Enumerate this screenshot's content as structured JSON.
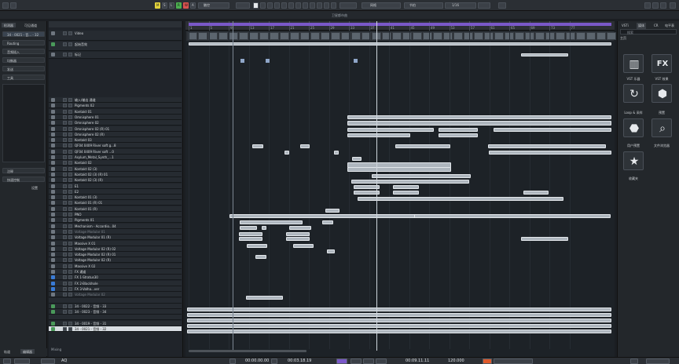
{
  "toolbar": {
    "mode_label": "触控",
    "grid_label": "网格",
    "grid_mode": "节拍",
    "quantize": "1/16",
    "letters": [
      "M",
      "S",
      "L",
      "R",
      "W",
      "A"
    ]
  },
  "window": {
    "project_title": "卫星都市曲"
  },
  "inspector": {
    "tabs": [
      "检测器",
      "可见通道"
    ],
    "track_name": "34 - 0021 - 音... - 32",
    "sections": [
      "Routing",
      "音频插入",
      "均衡器",
      "发送",
      "工具"
    ],
    "lower_sections": [
      "注释",
      "快速控制"
    ],
    "setting_label": "设置",
    "bottom_tabs": [
      "轨道",
      "编辑器"
    ],
    "footer_label": "Mixing"
  },
  "tracks": [
    {
      "name": "Video",
      "type": "video"
    },
    {
      "name": "起始音效",
      "type": "audio"
    },
    {
      "name": "标记",
      "type": "marker"
    },
    {
      "name": "输入/输出 通道",
      "type": "folder"
    },
    {
      "name": "Pigments 02",
      "type": "inst"
    },
    {
      "name": "Kontakt 01",
      "type": "inst"
    },
    {
      "name": "Omnisphere 01",
      "type": "inst"
    },
    {
      "name": "Omnisphere 02",
      "type": "inst"
    },
    {
      "name": "Omnisphere 02 (R) 01",
      "type": "inst"
    },
    {
      "name": "Omnisphere 02 (R)",
      "type": "inst"
    },
    {
      "name": "Kontakt 03",
      "type": "inst"
    },
    {
      "name": "QF04 0409 River soft g...8",
      "type": "inst"
    },
    {
      "name": "QF04 0409 River soft ...0",
      "type": "inst"
    },
    {
      "name": "Asylum_Metal_Synth_...1",
      "type": "inst"
    },
    {
      "name": "Kontakt 02",
      "type": "inst"
    },
    {
      "name": "Kontakt 02 (3)",
      "type": "inst"
    },
    {
      "name": "Kontakt 02 (3) (R) 01",
      "type": "inst"
    },
    {
      "name": "Kontakt 02 (3) (R)",
      "type": "inst"
    },
    {
      "name": "E1",
      "type": "inst"
    },
    {
      "name": "E2",
      "type": "inst"
    },
    {
      "name": "Kontakt 01 (3)",
      "type": "inst"
    },
    {
      "name": "Kontakt 01 (R) 01",
      "type": "inst"
    },
    {
      "name": "Kontakt 01 (R)",
      "type": "inst"
    },
    {
      "name": "PNO",
      "type": "inst"
    },
    {
      "name": "Pigments 01",
      "type": "inst"
    },
    {
      "name": "Mechanism - Accordio...04",
      "type": "inst"
    },
    {
      "name": "Voltage Modular 01",
      "type": "inst",
      "dim": true
    },
    {
      "name": "Voltage Modular 01 (R)",
      "type": "inst"
    },
    {
      "name": "Massive X 01",
      "type": "inst"
    },
    {
      "name": "Voltage Modular 02 (R) 02",
      "type": "inst"
    },
    {
      "name": "Voltage Modular 02 (R) 01",
      "type": "inst"
    },
    {
      "name": "Voltage Modular 02 (R)",
      "type": "inst"
    },
    {
      "name": "Massive X 02",
      "type": "inst"
    },
    {
      "name": "FX 通道",
      "type": "folder"
    },
    {
      "name": "FX 1-Stratus30",
      "type": "fx"
    },
    {
      "name": "FX 2-Blackhole",
      "type": "fx"
    },
    {
      "name": "FX 3-Valha...ver",
      "type": "fx"
    },
    {
      "name": "Voltage Modular 02",
      "type": "inst",
      "dim": true
    },
    {
      "name": "",
      "type": "empty"
    },
    {
      "name": "34 - 0022 - 音频 - 33",
      "type": "audio"
    },
    {
      "name": "34 - 0023 - 音频 - 34",
      "type": "audio"
    },
    {
      "name": "",
      "type": "empty"
    },
    {
      "name": "34 - 0019 - 音频 - 31",
      "type": "audio"
    },
    {
      "name": "34 - 0021 - 音频 - 32",
      "type": "audio",
      "selected": true
    }
  ],
  "ruler": {
    "bars": [
      "1",
      "5",
      "9",
      "13",
      "17",
      "21",
      "25",
      "29",
      "33",
      "37",
      "41",
      "45",
      "49",
      "53",
      "57",
      "61",
      "65",
      "69",
      "73",
      "77"
    ]
  },
  "rightzone": {
    "tabs": [
      "VSTi",
      "媒体",
      "CR",
      "电平表"
    ],
    "search_placeholder": "搜索",
    "home_label": "主页",
    "tiles": [
      {
        "label": "VST 乐器",
        "icon": "piano-icon"
      },
      {
        "label": "VST 效果",
        "icon": "fx-icon"
      },
      {
        "label": "Loop & 采样",
        "icon": "loop-icon"
      },
      {
        "label": "预置",
        "icon": "preset-icon"
      },
      {
        "label": "用户预置",
        "icon": "user-preset-icon"
      },
      {
        "label": "文件浏览器",
        "icon": "file-browser-icon"
      },
      {
        "label": "收藏夹",
        "icon": "star-icon"
      }
    ]
  },
  "transport": {
    "left_locator": "00:00.00.00",
    "right_locator": "00:03.18.19",
    "position": "00:09.11.11",
    "tempo": "120.000",
    "marker": "AQ"
  }
}
